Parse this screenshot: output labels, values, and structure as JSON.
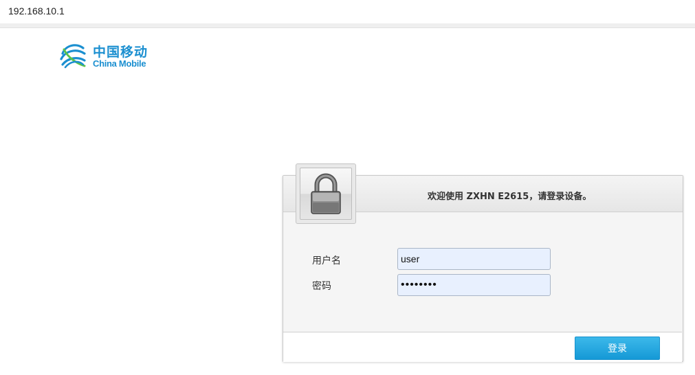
{
  "browser": {
    "url": "192.168.10.1"
  },
  "logo": {
    "cn": "中国移动",
    "en": "China Mobile",
    "icon": "china-mobile-logo",
    "color": "#1b8fd0"
  },
  "login": {
    "title": "欢迎使用 ZXHN E2615，请登录设备。",
    "lock_icon": "padlock",
    "username_label": "用户名",
    "username_value": "user",
    "password_label": "密码",
    "password_value": "••••••••",
    "submit_label": "登录",
    "accent_color": "#1599d6"
  }
}
